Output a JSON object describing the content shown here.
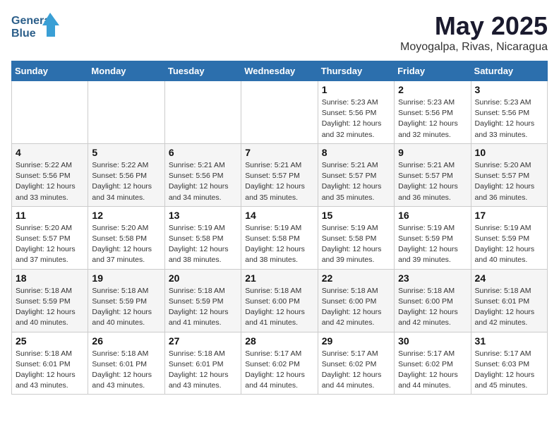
{
  "logo": {
    "line1": "General",
    "line2": "Blue"
  },
  "title": "May 2025",
  "subtitle": "Moyogalpa, Rivas, Nicaragua",
  "days_of_week": [
    "Sunday",
    "Monday",
    "Tuesday",
    "Wednesday",
    "Thursday",
    "Friday",
    "Saturday"
  ],
  "weeks": [
    [
      {
        "num": "",
        "info": ""
      },
      {
        "num": "",
        "info": ""
      },
      {
        "num": "",
        "info": ""
      },
      {
        "num": "",
        "info": ""
      },
      {
        "num": "1",
        "info": "Sunrise: 5:23 AM\nSunset: 5:56 PM\nDaylight: 12 hours\nand 32 minutes."
      },
      {
        "num": "2",
        "info": "Sunrise: 5:23 AM\nSunset: 5:56 PM\nDaylight: 12 hours\nand 32 minutes."
      },
      {
        "num": "3",
        "info": "Sunrise: 5:23 AM\nSunset: 5:56 PM\nDaylight: 12 hours\nand 33 minutes."
      }
    ],
    [
      {
        "num": "4",
        "info": "Sunrise: 5:22 AM\nSunset: 5:56 PM\nDaylight: 12 hours\nand 33 minutes."
      },
      {
        "num": "5",
        "info": "Sunrise: 5:22 AM\nSunset: 5:56 PM\nDaylight: 12 hours\nand 34 minutes."
      },
      {
        "num": "6",
        "info": "Sunrise: 5:21 AM\nSunset: 5:56 PM\nDaylight: 12 hours\nand 34 minutes."
      },
      {
        "num": "7",
        "info": "Sunrise: 5:21 AM\nSunset: 5:57 PM\nDaylight: 12 hours\nand 35 minutes."
      },
      {
        "num": "8",
        "info": "Sunrise: 5:21 AM\nSunset: 5:57 PM\nDaylight: 12 hours\nand 35 minutes."
      },
      {
        "num": "9",
        "info": "Sunrise: 5:21 AM\nSunset: 5:57 PM\nDaylight: 12 hours\nand 36 minutes."
      },
      {
        "num": "10",
        "info": "Sunrise: 5:20 AM\nSunset: 5:57 PM\nDaylight: 12 hours\nand 36 minutes."
      }
    ],
    [
      {
        "num": "11",
        "info": "Sunrise: 5:20 AM\nSunset: 5:57 PM\nDaylight: 12 hours\nand 37 minutes."
      },
      {
        "num": "12",
        "info": "Sunrise: 5:20 AM\nSunset: 5:58 PM\nDaylight: 12 hours\nand 37 minutes."
      },
      {
        "num": "13",
        "info": "Sunrise: 5:19 AM\nSunset: 5:58 PM\nDaylight: 12 hours\nand 38 minutes."
      },
      {
        "num": "14",
        "info": "Sunrise: 5:19 AM\nSunset: 5:58 PM\nDaylight: 12 hours\nand 38 minutes."
      },
      {
        "num": "15",
        "info": "Sunrise: 5:19 AM\nSunset: 5:58 PM\nDaylight: 12 hours\nand 39 minutes."
      },
      {
        "num": "16",
        "info": "Sunrise: 5:19 AM\nSunset: 5:59 PM\nDaylight: 12 hours\nand 39 minutes."
      },
      {
        "num": "17",
        "info": "Sunrise: 5:19 AM\nSunset: 5:59 PM\nDaylight: 12 hours\nand 40 minutes."
      }
    ],
    [
      {
        "num": "18",
        "info": "Sunrise: 5:18 AM\nSunset: 5:59 PM\nDaylight: 12 hours\nand 40 minutes."
      },
      {
        "num": "19",
        "info": "Sunrise: 5:18 AM\nSunset: 5:59 PM\nDaylight: 12 hours\nand 40 minutes."
      },
      {
        "num": "20",
        "info": "Sunrise: 5:18 AM\nSunset: 5:59 PM\nDaylight: 12 hours\nand 41 minutes."
      },
      {
        "num": "21",
        "info": "Sunrise: 5:18 AM\nSunset: 6:00 PM\nDaylight: 12 hours\nand 41 minutes."
      },
      {
        "num": "22",
        "info": "Sunrise: 5:18 AM\nSunset: 6:00 PM\nDaylight: 12 hours\nand 42 minutes."
      },
      {
        "num": "23",
        "info": "Sunrise: 5:18 AM\nSunset: 6:00 PM\nDaylight: 12 hours\nand 42 minutes."
      },
      {
        "num": "24",
        "info": "Sunrise: 5:18 AM\nSunset: 6:01 PM\nDaylight: 12 hours\nand 42 minutes."
      }
    ],
    [
      {
        "num": "25",
        "info": "Sunrise: 5:18 AM\nSunset: 6:01 PM\nDaylight: 12 hours\nand 43 minutes."
      },
      {
        "num": "26",
        "info": "Sunrise: 5:18 AM\nSunset: 6:01 PM\nDaylight: 12 hours\nand 43 minutes."
      },
      {
        "num": "27",
        "info": "Sunrise: 5:18 AM\nSunset: 6:01 PM\nDaylight: 12 hours\nand 43 minutes."
      },
      {
        "num": "28",
        "info": "Sunrise: 5:17 AM\nSunset: 6:02 PM\nDaylight: 12 hours\nand 44 minutes."
      },
      {
        "num": "29",
        "info": "Sunrise: 5:17 AM\nSunset: 6:02 PM\nDaylight: 12 hours\nand 44 minutes."
      },
      {
        "num": "30",
        "info": "Sunrise: 5:17 AM\nSunset: 6:02 PM\nDaylight: 12 hours\nand 44 minutes."
      },
      {
        "num": "31",
        "info": "Sunrise: 5:17 AM\nSunset: 6:03 PM\nDaylight: 12 hours\nand 45 minutes."
      }
    ]
  ]
}
